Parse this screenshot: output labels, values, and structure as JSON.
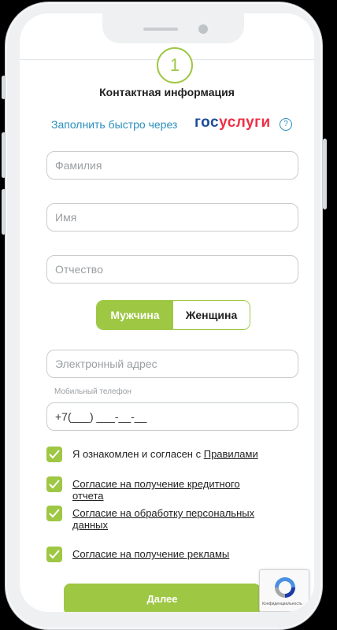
{
  "step": {
    "number": "1"
  },
  "form": {
    "title": "Контактная информация",
    "gosuslugi": {
      "prefix": "Заполнить быстро через",
      "logo_part1": "гос",
      "logo_part2": "услуги",
      "help": "?"
    },
    "fields": {
      "last_name_placeholder": "Фамилия",
      "first_name_placeholder": "Имя",
      "middle_name_placeholder": "Отчество",
      "email_placeholder": "Электронный адрес",
      "phone_label": "Мобильный телефон",
      "phone_value": "+7(___) ___-__-__"
    },
    "gender": {
      "male": "Мужчина",
      "female": "Женщина",
      "selected": "male"
    },
    "consents": [
      {
        "text": "Я ознакомлен и согласен с ",
        "link": "Правилами",
        "checked": true
      },
      {
        "link": "Согласие на получение кредитного отчета",
        "checked": true
      },
      {
        "link": "Согласие на обработку персональных данных",
        "checked": true
      },
      {
        "link": "Согласие на получение рекламы",
        "checked": true
      }
    ],
    "next_label": "Далее",
    "recaptcha_text": "Конфиденциальность"
  },
  "colors": {
    "accent": "#9ec744",
    "link": "#2a8fbd",
    "gos_blue": "#1d4d99",
    "gos_red": "#ee2f45"
  },
  "icons": {
    "check": "check-icon",
    "help": "question-icon",
    "recaptcha": "recaptcha-icon"
  }
}
